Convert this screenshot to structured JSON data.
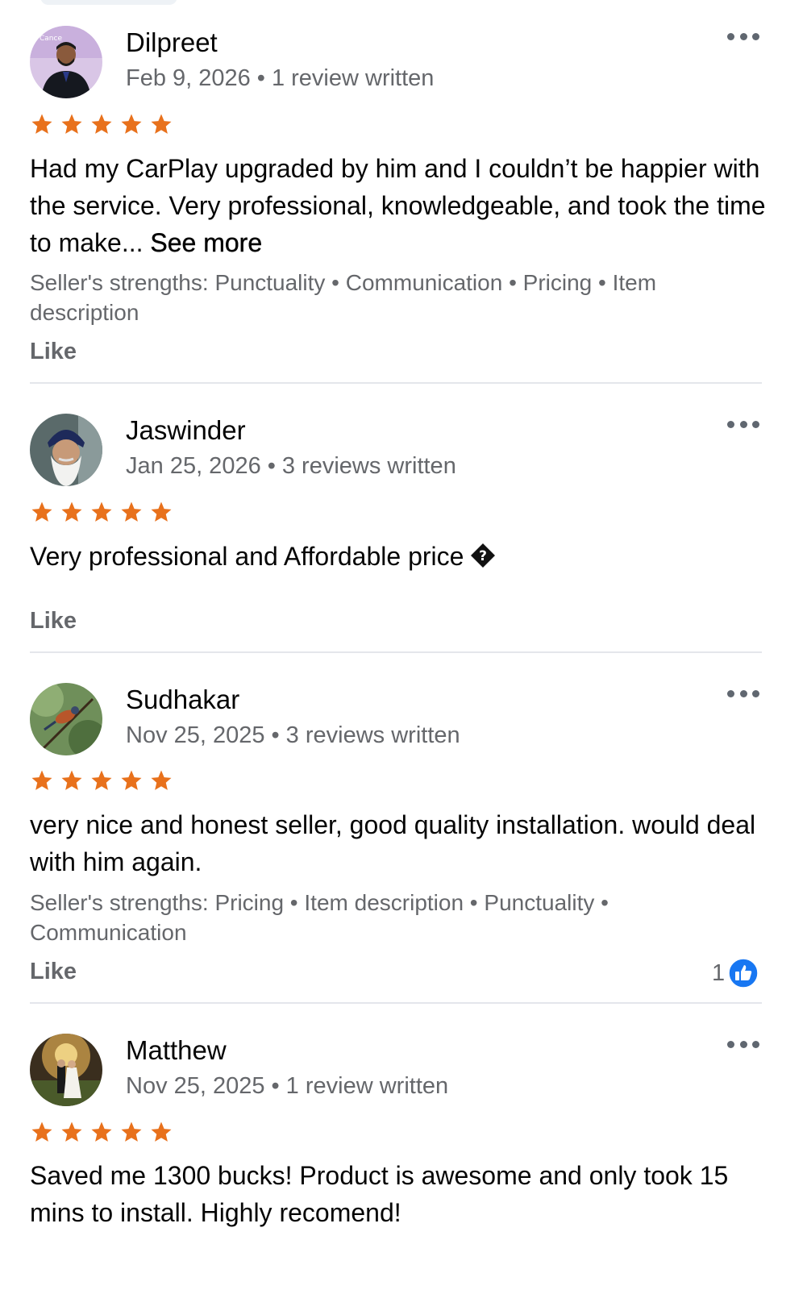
{
  "reviews": [
    {
      "name": "Dilpreet",
      "date": "Feb 9, 2026",
      "reviews_written": "1 review written",
      "rating": 5,
      "text": "Had my CarPlay upgraded by him and I couldn’t be happier with the service. Very professional, knowledgeable, and took the time to make...",
      "see_more": "See more",
      "strengths": "Seller's strengths: Punctuality • Communication • Pricing • Item description",
      "like_label": "Like"
    },
    {
      "name": "Jaswinder",
      "date": "Jan 25, 2026",
      "reviews_written": "3 reviews written",
      "rating": 5,
      "text": "Very professional and Affordable price",
      "like_label": "Like"
    },
    {
      "name": "Sudhakar",
      "date": "Nov 25, 2025",
      "reviews_written": "3 reviews written",
      "rating": 5,
      "text": "very nice and honest seller, good quality installation. would deal with him again.",
      "strengths": "Seller's strengths: Pricing • Item description • Punctuality • Communication",
      "like_label": "Like",
      "like_count": "1"
    },
    {
      "name": "Matthew",
      "date": "Nov 25, 2025",
      "reviews_written": "1 review written",
      "rating": 5,
      "text": "Saved me 1300 bucks! Product is awesome and only took 15 mins to install. Highly recomend!"
    }
  ],
  "separator": "•",
  "colors": {
    "star": "#e8711c",
    "meta_text": "#65676b",
    "like_badge": "#1877f2",
    "divider": "#e4e6eb"
  },
  "icons": {
    "more": "more-options-icon",
    "star": "star-icon",
    "like_badge": "thumbs-up-icon",
    "unknown_char": "replacement-character-icon"
  }
}
